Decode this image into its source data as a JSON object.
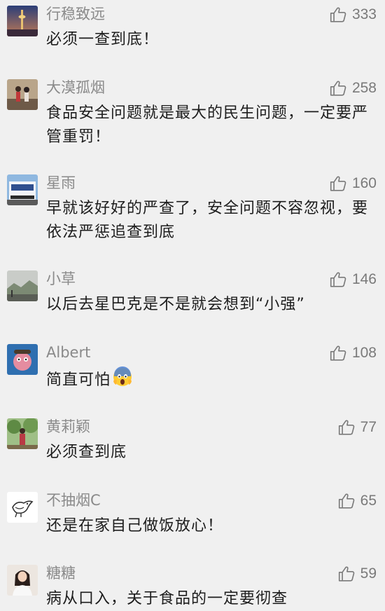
{
  "comments": [
    {
      "name": "行稳致远",
      "likes": "333",
      "text": "必须一查到底！",
      "avatar": "tower-photo-avatar"
    },
    {
      "name": "大漠孤烟",
      "likes": "258",
      "text": "食品安全问题就是最大的民生问题，一定要严管重罚！",
      "avatar": "people-photo-avatar"
    },
    {
      "name": "星雨",
      "likes": "160",
      "text": "早就该好好的严查了，安全问题不容忽视，要依法严惩追查到底",
      "avatar": "bus-photo-avatar"
    },
    {
      "name": "小草",
      "likes": "146",
      "text": "以后去星巴克是不是就会想到“小强”",
      "avatar": "landscape-photo-avatar"
    },
    {
      "name": "Albert",
      "likes": "108",
      "text": "简直可怕",
      "avatar": "cartoon-avatar",
      "emoji": "screaming-face-emoji"
    },
    {
      "name": "黄莉颖",
      "likes": "77",
      "text": "必须查到底",
      "avatar": "person-tree-photo-avatar"
    },
    {
      "name": "不抽烟C",
      "likes": "65",
      "text": "还是在家自己做饭放心！",
      "avatar": "bird-drawing-avatar"
    },
    {
      "name": "糖糖",
      "likes": "59",
      "text": "病从口入，关于食品的一定要彻查",
      "avatar": "girl-photo-avatar"
    }
  ],
  "icons": {
    "like": "thumbs-up-icon"
  }
}
